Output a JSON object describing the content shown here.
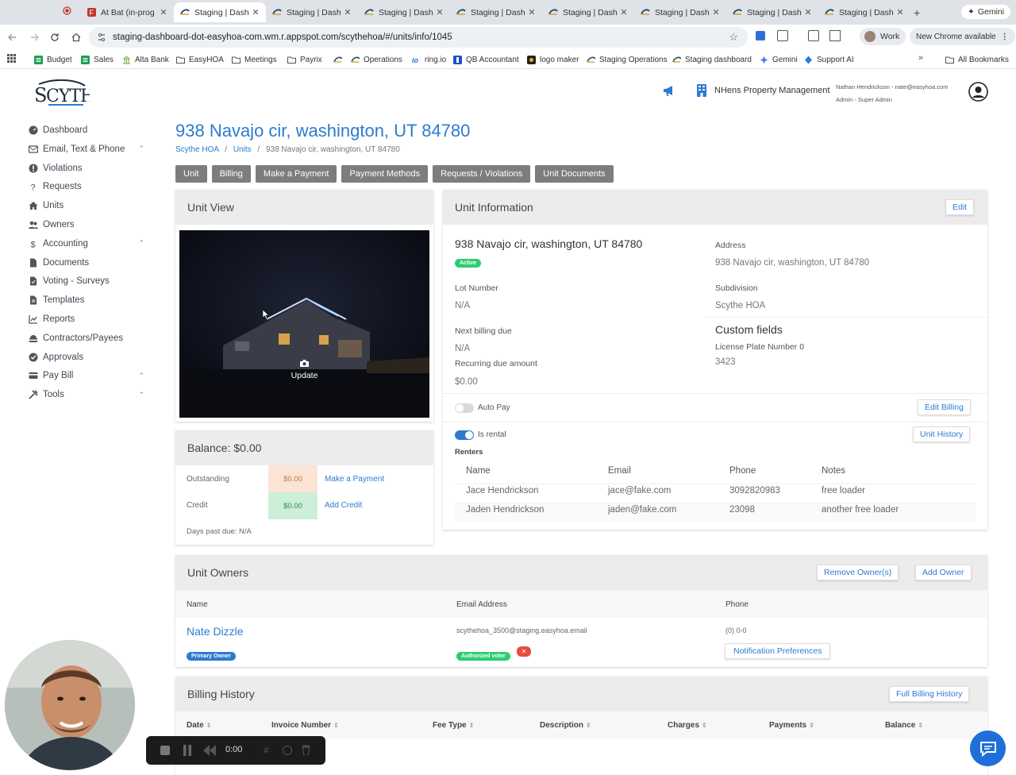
{
  "browser": {
    "tabs": [
      {
        "label": "At Bat (in-prog",
        "icon": "record-icon"
      },
      {
        "label": "Staging | Dash",
        "icon": "scythe-icon"
      },
      {
        "label": "Staging | Dash",
        "icon": "scythe-icon"
      },
      {
        "label": "Staging | Dash",
        "icon": "scythe-icon"
      },
      {
        "label": "Staging | Dash",
        "icon": "scythe-icon"
      },
      {
        "label": "Staging | Dash",
        "icon": "scythe-icon"
      },
      {
        "label": "Staging | Dash",
        "icon": "scythe-icon"
      },
      {
        "label": "Staging | Dash",
        "icon": "scythe-icon"
      },
      {
        "label": "Staging | Dash",
        "icon": "scythe-icon"
      }
    ],
    "new_tab": "+",
    "gemini_label": "Gemini",
    "url": "staging-dashboard-dot-easyhoa-com.wm.r.appspot.com/scythehoa/#/units/info/1045",
    "profile_label": "Work",
    "update_label": "New Chrome available",
    "bookmarks": [
      {
        "label": "Budget",
        "icon": "sheets-icon"
      },
      {
        "label": "Sales",
        "icon": "sheets-icon"
      },
      {
        "label": "Alta Bank",
        "icon": "bank-icon"
      },
      {
        "label": "EasyHOA",
        "icon": "folder-icon"
      },
      {
        "label": "Meetings",
        "icon": "folder-icon"
      },
      {
        "label": "Payrix",
        "icon": "folder-icon"
      },
      {
        "label": "",
        "icon": "scythe-icon"
      },
      {
        "label": "Operations",
        "icon": "scythe-icon"
      },
      {
        "label": "ring.io",
        "icon": "ring-icon"
      },
      {
        "label": "QB Accountant",
        "icon": "qb-icon"
      },
      {
        "label": "logo maker",
        "icon": "logo-icon"
      },
      {
        "label": "Staging Operations",
        "icon": "scythe-icon"
      },
      {
        "label": "Staging dashboard",
        "icon": "scythe-icon"
      },
      {
        "label": "Gemini",
        "icon": "gemini-icon"
      },
      {
        "label": "Support AI",
        "icon": "support-icon"
      }
    ],
    "all_bookmarks": "All Bookmarks"
  },
  "app": {
    "logo_text": "SCYTHE",
    "sidebar": [
      {
        "label": "Dashboard",
        "icon": "dashboard-icon",
        "chevron": false
      },
      {
        "label": "Email, Text & Phone",
        "icon": "email-icon",
        "chevron": true
      },
      {
        "label": "Violations",
        "icon": "violations-icon",
        "chevron": false
      },
      {
        "label": "Requests",
        "icon": "question-icon",
        "chevron": false
      },
      {
        "label": "Units",
        "icon": "home-icon",
        "chevron": false
      },
      {
        "label": "Owners",
        "icon": "owners-icon",
        "chevron": false
      },
      {
        "label": "Accounting",
        "icon": "dollar-icon",
        "chevron": true
      },
      {
        "label": "Documents",
        "icon": "document-icon",
        "chevron": false
      },
      {
        "label": "Voting - Surveys",
        "icon": "voting-icon",
        "chevron": false
      },
      {
        "label": "Templates",
        "icon": "template-icon",
        "chevron": false
      },
      {
        "label": "Reports",
        "icon": "chart-icon",
        "chevron": false
      },
      {
        "label": "Contractors/Payees",
        "icon": "contractor-icon",
        "chevron": false
      },
      {
        "label": "Approvals",
        "icon": "check-icon",
        "chevron": false
      },
      {
        "label": "Pay Bill",
        "icon": "card-icon",
        "chevron": true
      },
      {
        "label": "Tools",
        "icon": "tools-icon",
        "chevron": true
      }
    ],
    "header": {
      "company": "NHens Property Management",
      "user_line": "Nathan Hendrickson - nate@easyhoa.com",
      "role": "Admin - Super Admin"
    },
    "page_title": "938 Navajo cir, washington, UT 84780",
    "breadcrumb": {
      "root": "Scythe HOA",
      "sep": "/",
      "mid": "Units",
      "current": "938 Navajo cir, washington, UT 84780"
    },
    "tabs": [
      "Unit",
      "Billing",
      "Make a Payment",
      "Payment Methods",
      "Requests / Violations",
      "Unit Documents"
    ],
    "unit_view": {
      "title": "Unit View",
      "update_label": "Update"
    },
    "balance": {
      "title": "Balance: $0.00",
      "outstanding_label": "Outstanding",
      "outstanding_value": "$0.00",
      "outstanding_action": "Make a Payment",
      "credit_label": "Credit",
      "credit_value": "$0.00",
      "credit_action": "Add Credit",
      "days_past_due": "Days past due: N/A"
    },
    "unit_info": {
      "title": "Unit Information",
      "edit_label": "Edit",
      "address_heading": "938 Navajo cir, washington, UT 84780",
      "status_badge": "Active",
      "address_label": "Address",
      "address_value": "938 Navajo cir, washington, UT 84780",
      "lot_label": "Lot Number",
      "lot_value": "N/A",
      "subdivision_label": "Subdivision",
      "subdivision_value": "Scythe HOA",
      "billing_due_label": "Next billing due",
      "billing_due_value": "N/A",
      "custom_fields_title": "Custom fields",
      "plate_label": "License Plate Number 0",
      "plate_value": "3423",
      "recurring_label": "Recurring due amount",
      "recurring_value": "$0.00",
      "autopay_label": "Auto Pay",
      "autopay_on": false,
      "edit_billing_label": "Edit Billing",
      "rental_label": "Is rental",
      "rental_on": true,
      "unit_history_label": "Unit History",
      "renters_label": "Renters",
      "renter_columns": [
        "Name",
        "Email",
        "Phone",
        "Notes"
      ],
      "renters": [
        {
          "name": "Jace Hendrickson",
          "email": "jace@fake.com",
          "phone": "3092820983",
          "notes": "free loader"
        },
        {
          "name": "Jaden Hendrickson",
          "email": "jaden@fake.com",
          "phone": "23098",
          "notes": "another free loader"
        }
      ]
    },
    "owners": {
      "title": "Unit Owners",
      "remove_label": "Remove Owner(s)",
      "add_label": "Add Owner",
      "columns": [
        "Name",
        "Email Address",
        "Phone"
      ],
      "name": "Nate Dizzle",
      "primary_badge": "Primary Owner",
      "email": "scythehoa_3500@staging.easyhoa.email",
      "voter_badge": "Authorized voter",
      "remove_badge": "✕",
      "phone": "(0) 0-0",
      "notif_label": "Notification Preferences"
    },
    "billing": {
      "title": "Billing History",
      "full_label": "Full Billing History",
      "columns": [
        "Date",
        "Invoice Number",
        "Fee Type",
        "Description",
        "Charges",
        "Payments",
        "Balance"
      ]
    },
    "recorder": {
      "time": "0:00"
    }
  },
  "colors": {
    "accent": "#2d7bd0",
    "active_green": "#2ecc71",
    "outstanding_bg": "#fbe3d6",
    "credit_bg": "#cdeed8",
    "chip_red": "#e74c3c",
    "gray_button": "#7d7d7d"
  }
}
